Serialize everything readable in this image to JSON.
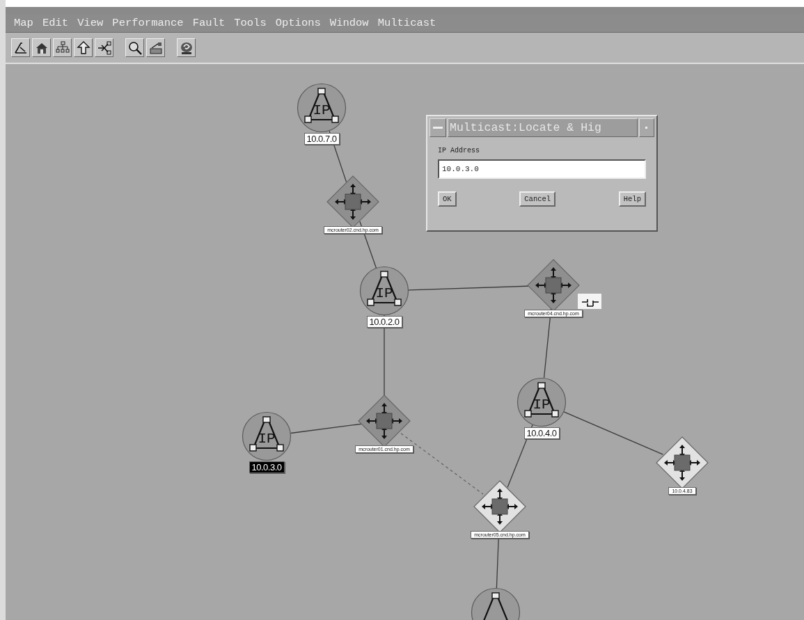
{
  "menu_bar": [
    {
      "label": "Map"
    },
    {
      "label": "Edit"
    },
    {
      "label": "View"
    },
    {
      "label": "Performance"
    },
    {
      "label": "Fault"
    },
    {
      "label": "Tools"
    },
    {
      "label": "Options"
    },
    {
      "label": "Window"
    },
    {
      "label": "Multicast"
    }
  ],
  "toolbar": [
    {
      "kind": "close-map"
    },
    {
      "kind": "home"
    },
    {
      "kind": "root"
    },
    {
      "kind": "up"
    },
    {
      "kind": "quick-navigator"
    },
    {
      "kind": "zoom"
    },
    {
      "kind": "pan"
    },
    {
      "kind": "help"
    }
  ],
  "map": {
    "nodes": [
      {
        "kind": "ip",
        "symbol": "IP",
        "label": "10.0.7.0",
        "selected": false
      },
      {
        "kind": "router",
        "label": "mcrouter02.cnd.hp.com",
        "selected": false,
        "highlighted": false
      },
      {
        "kind": "ip",
        "symbol": "IP",
        "label": "10.0.2.0",
        "selected": false
      },
      {
        "kind": "router",
        "label": "mcrouter04.cnd.hp.com",
        "selected": false,
        "highlighted": false
      },
      {
        "kind": "ip",
        "symbol": "IP",
        "label": "10.0.3.0",
        "selected": true
      },
      {
        "kind": "router",
        "label": "mcrouter01.cnd.hp.com",
        "selected": false,
        "highlighted": false
      },
      {
        "kind": "ip",
        "symbol": "IP",
        "label": "10.0.4.0",
        "selected": false
      },
      {
        "kind": "router",
        "label": "10.0.4.83",
        "selected": false,
        "highlighted": true
      },
      {
        "kind": "router",
        "label": "mcrouter05.cnd.hp.com",
        "selected": false,
        "highlighted": true
      },
      {
        "kind": "ip"
      }
    ]
  },
  "dialog": {
    "title": "Multicast:Locate & Hig",
    "field_label": "IP Address",
    "field_value": "10.0.3.0",
    "buttons": [
      "OK",
      "Cancel",
      "Help"
    ]
  }
}
